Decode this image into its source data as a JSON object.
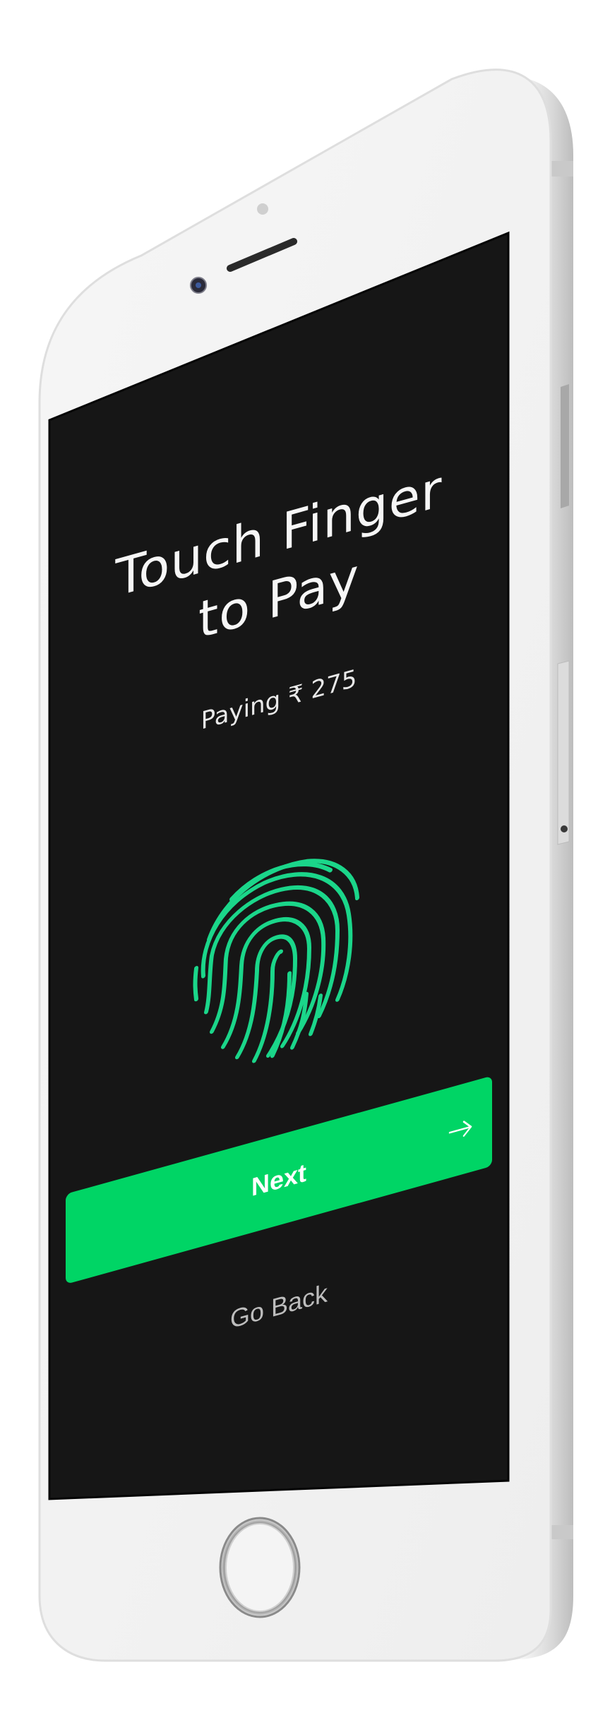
{
  "screen": {
    "title_lines": [
      "Touch Finger",
      "to Pay"
    ],
    "subtitle": "Paying ₹ 275",
    "fingerprint_icon": "fingerprint-icon",
    "next_button_label": "Next",
    "next_arrow_icon": "arrow-right-icon",
    "back_link_label": "Go Back"
  },
  "colors": {
    "screen_background": "#161616",
    "accent_green": "#00d565",
    "fingerprint_green": "#1bd68a",
    "phone_body": "#f2f2f2",
    "title_text": "#f6f6f6",
    "back_link_text": "#bdbdbd"
  }
}
